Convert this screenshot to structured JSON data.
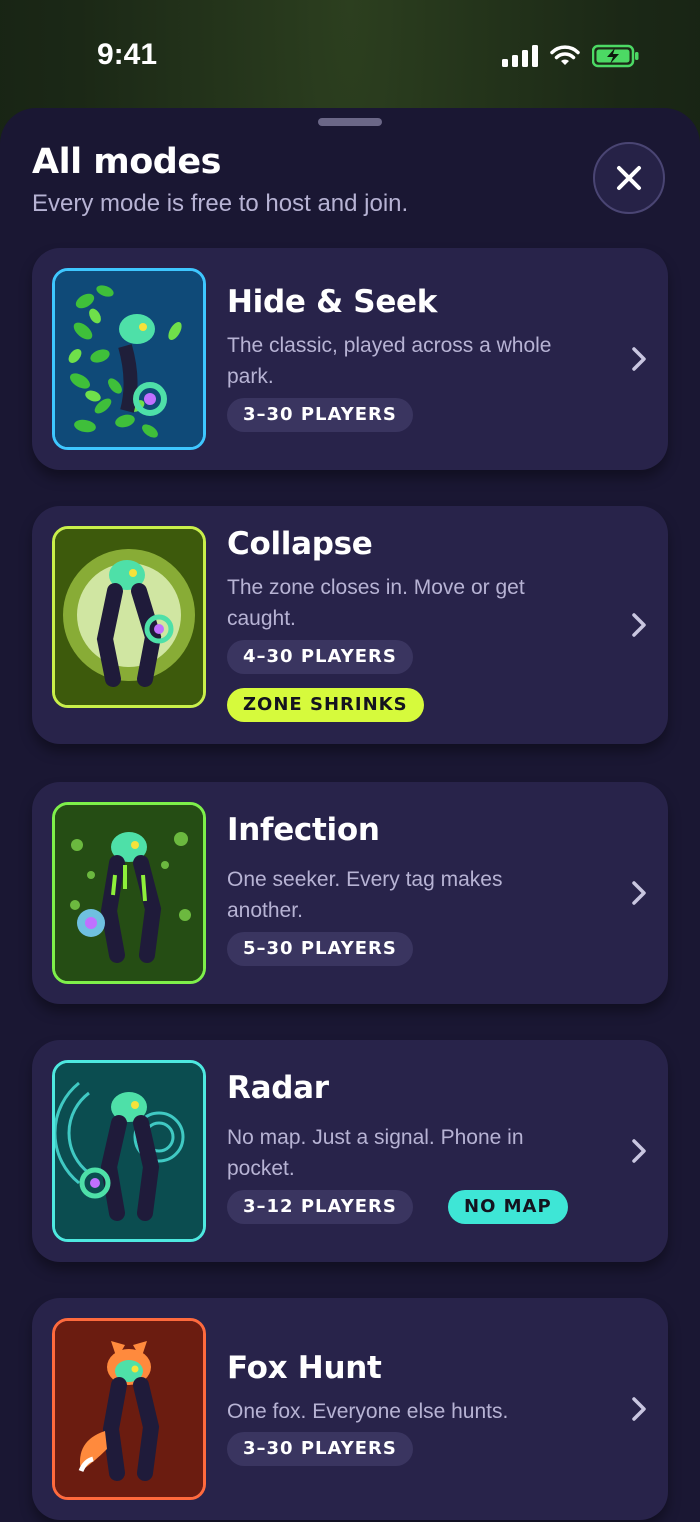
{
  "status_bar": {
    "time": "9:41"
  },
  "sheet": {
    "title": "All modes",
    "subtitle": "Every mode is free to host and join."
  },
  "modes": [
    {
      "title": "Hide & Seek",
      "description": "The classic, played across a whole park.",
      "players": "3–30 PLAYERS",
      "tags": [],
      "frame_color": "#3ec7ff",
      "bg_color": "#0f4a78"
    },
    {
      "title": "Collapse",
      "description": "The zone closes in. Move or get caught.",
      "players": "4–30 PLAYERS",
      "tags": [
        "ZONE SHRINKS"
      ],
      "frame_color": "#c9f04a",
      "bg_color": "#3d5a0c"
    },
    {
      "title": "Infection",
      "description": "One seeker. Every tag makes another.",
      "players": "5–30 PLAYERS",
      "tags": [],
      "frame_color": "#7ef04a",
      "bg_color": "#254d14"
    },
    {
      "title": "Radar",
      "description": "No map. Just a signal. Phone in pocket.",
      "players": "3–12 PLAYERS",
      "tags": [
        "NO MAP"
      ],
      "frame_color": "#4ee9e0",
      "bg_color": "#0b4d50"
    },
    {
      "title": "Fox Hunt",
      "description": "One fox. Everyone else hunts.",
      "players": "3–30 PLAYERS",
      "tags": [],
      "frame_color": "#ff6a3d",
      "bg_color": "#6b1c10"
    }
  ]
}
